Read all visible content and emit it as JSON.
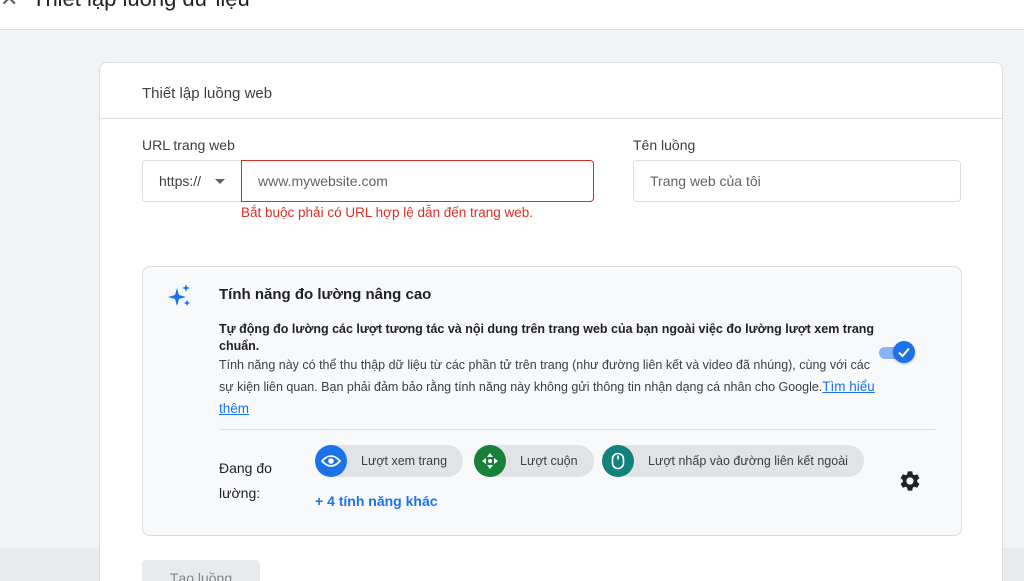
{
  "page": {
    "title": "Thiết lập luồng dữ liệu",
    "close_icon": "close-icon"
  },
  "card": {
    "header": "Thiết lập luồng web"
  },
  "url_field": {
    "label": "URL trang web",
    "protocol": "https://",
    "placeholder": "www.mywebsite.com",
    "value": "",
    "error": "Bắt buộc phải có URL hợp lệ dẫn đến trang web."
  },
  "name_field": {
    "label": "Tên luồng",
    "placeholder": "Trang web của tôi",
    "value": ""
  },
  "enhanced_measurement": {
    "icon": "sparkle-icon",
    "title": "Tính năng đo lường nâng cao",
    "desc_bold": "Tự động đo lường các lượt tương tác và nội dung trên trang web của bạn ngoài việc đo lường lượt xem trang chuẩn.",
    "desc": "Tính năng này có thể thu thập dữ liệu từ các phần tử trên trang (như đường liên kết và video đã nhúng), cùng với các sự kiện liên quan. Bạn phải đảm bảo rằng tính năng này không gửi thông tin nhận dạng cá nhân cho Google.",
    "learn_more": "Tìm hiểu thêm",
    "toggle_on": true,
    "measuring_label": "Đang đo lường:",
    "chips": [
      {
        "label": "Lượt xem trang",
        "icon": "eye-icon",
        "color": "#1a73e8"
      },
      {
        "label": "Lượt cuộn",
        "icon": "scroll-icon",
        "color": "#188038"
      },
      {
        "label": "Lượt nhấp vào đường liên kết ngoài",
        "icon": "mouse-icon",
        "color": "#12827a"
      }
    ],
    "more_link": "+ 4 tính năng khác",
    "settings_icon": "gear-icon"
  },
  "actions": {
    "create_label": "Tạo luồng"
  },
  "colors": {
    "accent": "#1a73e8",
    "error": "#d93025"
  }
}
